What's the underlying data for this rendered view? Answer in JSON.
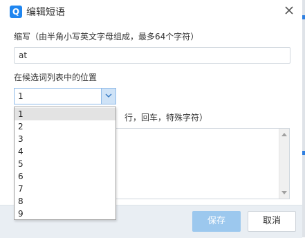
{
  "dialog": {
    "title": "编辑短语",
    "icon_glyph": "Q",
    "close_glyph": "close-icon"
  },
  "abbreviation": {
    "label": "缩写（由半角小写英文字母组成，最多64个字符）",
    "value": "at"
  },
  "position": {
    "label": "在候选词列表中的位置",
    "selected": "1",
    "options": [
      "1",
      "2",
      "3",
      "4",
      "5",
      "6",
      "7",
      "8",
      "9"
    ]
  },
  "content": {
    "label_visible": "行，回车，特殊字符）",
    "value": ""
  },
  "buttons": {
    "save": "保存",
    "cancel": "取消"
  },
  "colors": {
    "accent": "#1f86f0",
    "save_button": "#9cc8ee",
    "footer": "#e9eef3"
  }
}
